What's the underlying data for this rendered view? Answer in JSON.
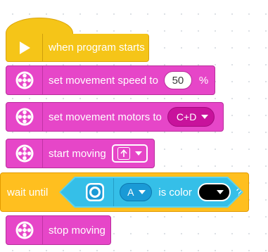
{
  "blocks": {
    "hat": {
      "label": "when program starts",
      "icon": "play-icon",
      "color": "#f5c518"
    },
    "set_speed": {
      "label": "set movement speed to",
      "value": "50",
      "unit": "%",
      "icon": "motor-icon",
      "color": "#e646c8"
    },
    "set_motors": {
      "label": "set movement motors to",
      "selected": "C+D",
      "icon": "motor-icon"
    },
    "start_moving": {
      "label": "start moving",
      "direction_icon": "arrow-up-icon",
      "icon": "motor-icon"
    },
    "wait_until": {
      "label": "wait until",
      "color": "#ffbf1f",
      "sensor": {
        "icon": "color-sensor-icon",
        "port": "A",
        "condition": "is color",
        "color_value": "#000000",
        "suffix": "?",
        "color": "#35bfe8"
      }
    },
    "stop_moving": {
      "label": "stop moving",
      "icon": "motor-icon"
    }
  }
}
